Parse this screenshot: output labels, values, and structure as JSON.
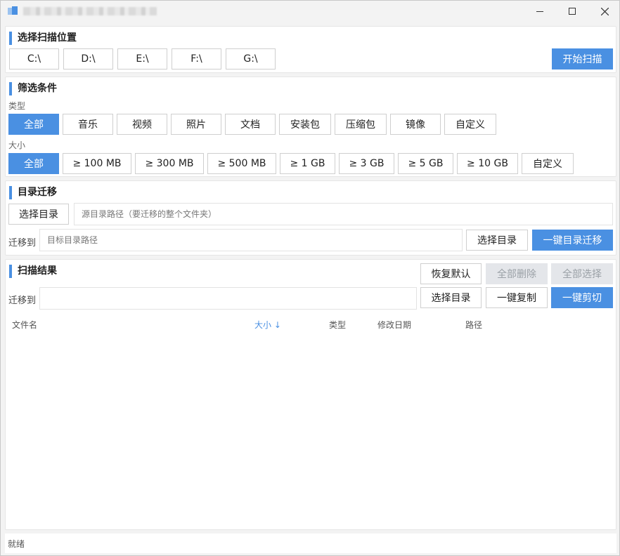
{
  "window": {
    "title_icon": "app-icon",
    "controls": {
      "minimize": "—",
      "maximize": "☐",
      "close": "✕"
    }
  },
  "scan_location": {
    "title": "选择扫描位置",
    "drives": [
      "C:\\",
      "D:\\",
      "E:\\",
      "F:\\",
      "G:\\"
    ],
    "start_label": "开始扫描"
  },
  "filters": {
    "title": "筛选条件",
    "type_label": "类型",
    "types": [
      "全部",
      "音乐",
      "视频",
      "照片",
      "文档",
      "安装包",
      "压缩包",
      "镜像",
      "自定义"
    ],
    "size_label": "大小",
    "sizes": [
      "全部",
      "≥ 100 MB",
      "≥ 300 MB",
      "≥ 500 MB",
      "≥ 1 GB",
      "≥ 3 GB",
      "≥ 5 GB",
      "≥ 10 GB",
      "自定义"
    ]
  },
  "migration": {
    "title": "目录迁移",
    "select_dir_label": "选择目录",
    "source_placeholder": "源目录路径（要迁移的整个文件夹）",
    "move_to_label": "迁移到",
    "target_placeholder": "目标目录路径",
    "select_dir_label2": "选择目录",
    "migrate_label": "一键目录迁移"
  },
  "results": {
    "title": "扫描结果",
    "restore_label": "恢复默认",
    "delete_all_label": "全部删除",
    "select_all_label": "全部选择",
    "move_to_label": "迁移到",
    "move_to_value": "",
    "select_dir_label": "选择目录",
    "copy_label": "一键复制",
    "cut_label": "一键剪切",
    "columns": [
      "文件名",
      "大小 ↓",
      "类型",
      "修改日期",
      "路径"
    ]
  },
  "status": {
    "text": "就绪"
  },
  "colors": {
    "accent": "#4a90e2",
    "disabled_bg": "#e4e6ea"
  }
}
